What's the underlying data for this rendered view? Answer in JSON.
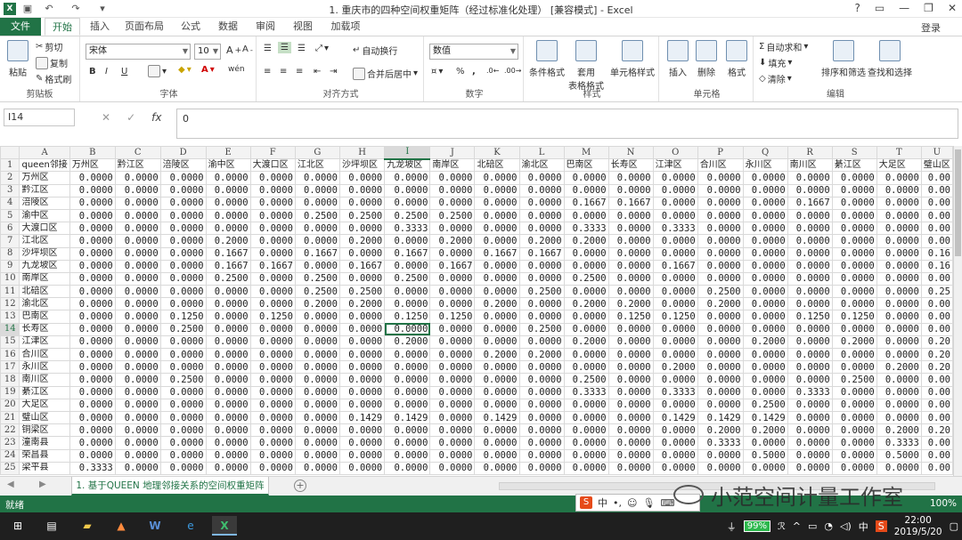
{
  "titlebar": {
    "title": "1. 重庆市的四种空间权重矩阵（经过标准化处理） [兼容模式] - Excel",
    "help": "?",
    "minimize": "—",
    "restore": "❐",
    "close": "✕"
  },
  "ribbon_tabs": [
    "文件",
    "开始",
    "插入",
    "页面布局",
    "公式",
    "数据",
    "审阅",
    "视图",
    "加载项"
  ],
  "login": "登录",
  "ribbon": {
    "clipboard": {
      "paste": "粘贴",
      "cut": "剪切",
      "copy": "复制",
      "format_painter": "格式刷",
      "label": "剪贴板"
    },
    "font": {
      "name": "宋体",
      "size": "10",
      "bold": "B",
      "italic": "I",
      "underline": "U",
      "wen": "wén",
      "label": "字体"
    },
    "alignment": {
      "wrap": "自动换行",
      "merge": "合并后居中",
      "label": "对齐方式"
    },
    "number": {
      "format": "数值",
      "pct": "%",
      "comma": ",",
      "label": "数字"
    },
    "styles": {
      "cond_format": "条件格式",
      "table_format": "套用\n表格格式",
      "cell_style": "单元格样式",
      "label": "样式"
    },
    "cells": {
      "insert": "插入",
      "delete": "删除",
      "format": "格式",
      "label": "单元格"
    },
    "editing": {
      "autosum": "自动求和",
      "fill": "填充",
      "clear": "清除",
      "sort": "排序和筛选",
      "find": "查找和选择",
      "label": "编辑"
    }
  },
  "formula_bar": {
    "name_box": "I14",
    "fx": "fx",
    "value": "0"
  },
  "grid": {
    "columns": [
      "A",
      "B",
      "C",
      "D",
      "E",
      "F",
      "G",
      "H",
      "I",
      "J",
      "K",
      "L",
      "M",
      "N",
      "O",
      "P",
      "Q",
      "R",
      "S",
      "T",
      "U"
    ],
    "selected_col": "I",
    "selected_row": 14,
    "header_row": [
      "queen邻接",
      "万州区",
      "黔江区",
      "涪陵区",
      "渝中区",
      "大渡口区",
      "江北区",
      "沙坪坝区",
      "九龙坡区",
      "南岸区",
      "北碚区",
      "渝北区",
      "巴南区",
      "长寿区",
      "江津区",
      "合川区",
      "永川区",
      "南川区",
      "綦江区",
      "大足区",
      "璧山区"
    ],
    "rows": [
      {
        "n": 2,
        "name": "万州区",
        "v": [
          "0.0000",
          "0.0000",
          "0.0000",
          "0.0000",
          "0.0000",
          "0.0000",
          "0.0000",
          "0.0000",
          "0.0000",
          "0.0000",
          "0.0000",
          "0.0000",
          "0.0000",
          "0.0000",
          "0.0000",
          "0.0000",
          "0.0000",
          "0.0000",
          "0.0000",
          "0.00"
        ]
      },
      {
        "n": 3,
        "name": "黔江区",
        "v": [
          "0.0000",
          "0.0000",
          "0.0000",
          "0.0000",
          "0.0000",
          "0.0000",
          "0.0000",
          "0.0000",
          "0.0000",
          "0.0000",
          "0.0000",
          "0.0000",
          "0.0000",
          "0.0000",
          "0.0000",
          "0.0000",
          "0.0000",
          "0.0000",
          "0.0000",
          "0.00"
        ]
      },
      {
        "n": 4,
        "name": "涪陵区",
        "v": [
          "0.0000",
          "0.0000",
          "0.0000",
          "0.0000",
          "0.0000",
          "0.0000",
          "0.0000",
          "0.0000",
          "0.0000",
          "0.0000",
          "0.0000",
          "0.1667",
          "0.1667",
          "0.0000",
          "0.0000",
          "0.0000",
          "0.1667",
          "0.0000",
          "0.0000",
          "0.00"
        ]
      },
      {
        "n": 5,
        "name": "渝中区",
        "v": [
          "0.0000",
          "0.0000",
          "0.0000",
          "0.0000",
          "0.0000",
          "0.2500",
          "0.2500",
          "0.2500",
          "0.2500",
          "0.0000",
          "0.0000",
          "0.0000",
          "0.0000",
          "0.0000",
          "0.0000",
          "0.0000",
          "0.0000",
          "0.0000",
          "0.0000",
          "0.00"
        ]
      },
      {
        "n": 6,
        "name": "大渡口区",
        "v": [
          "0.0000",
          "0.0000",
          "0.0000",
          "0.0000",
          "0.0000",
          "0.0000",
          "0.0000",
          "0.3333",
          "0.0000",
          "0.0000",
          "0.0000",
          "0.3333",
          "0.0000",
          "0.3333",
          "0.0000",
          "0.0000",
          "0.0000",
          "0.0000",
          "0.0000",
          "0.00"
        ]
      },
      {
        "n": 7,
        "name": "江北区",
        "v": [
          "0.0000",
          "0.0000",
          "0.0000",
          "0.2000",
          "0.0000",
          "0.0000",
          "0.2000",
          "0.0000",
          "0.2000",
          "0.0000",
          "0.2000",
          "0.2000",
          "0.0000",
          "0.0000",
          "0.0000",
          "0.0000",
          "0.0000",
          "0.0000",
          "0.0000",
          "0.00"
        ]
      },
      {
        "n": 8,
        "name": "沙坪坝区",
        "v": [
          "0.0000",
          "0.0000",
          "0.0000",
          "0.1667",
          "0.0000",
          "0.1667",
          "0.0000",
          "0.1667",
          "0.0000",
          "0.1667",
          "0.1667",
          "0.0000",
          "0.0000",
          "0.0000",
          "0.0000",
          "0.0000",
          "0.0000",
          "0.0000",
          "0.0000",
          "0.16"
        ]
      },
      {
        "n": 9,
        "name": "九龙坡区",
        "v": [
          "0.0000",
          "0.0000",
          "0.0000",
          "0.1667",
          "0.1667",
          "0.0000",
          "0.1667",
          "0.0000",
          "0.1667",
          "0.0000",
          "0.0000",
          "0.0000",
          "0.0000",
          "0.1667",
          "0.0000",
          "0.0000",
          "0.0000",
          "0.0000",
          "0.0000",
          "0.16"
        ]
      },
      {
        "n": 10,
        "name": "南岸区",
        "v": [
          "0.0000",
          "0.0000",
          "0.0000",
          "0.2500",
          "0.0000",
          "0.2500",
          "0.0000",
          "0.2500",
          "0.0000",
          "0.0000",
          "0.0000",
          "0.2500",
          "0.0000",
          "0.0000",
          "0.0000",
          "0.0000",
          "0.0000",
          "0.0000",
          "0.0000",
          "0.00"
        ]
      },
      {
        "n": 11,
        "name": "北碚区",
        "v": [
          "0.0000",
          "0.0000",
          "0.0000",
          "0.0000",
          "0.0000",
          "0.2500",
          "0.2500",
          "0.0000",
          "0.0000",
          "0.0000",
          "0.2500",
          "0.0000",
          "0.0000",
          "0.0000",
          "0.2500",
          "0.0000",
          "0.0000",
          "0.0000",
          "0.0000",
          "0.25"
        ]
      },
      {
        "n": 12,
        "name": "渝北区",
        "v": [
          "0.0000",
          "0.0000",
          "0.0000",
          "0.0000",
          "0.0000",
          "0.2000",
          "0.2000",
          "0.0000",
          "0.0000",
          "0.2000",
          "0.0000",
          "0.2000",
          "0.2000",
          "0.0000",
          "0.2000",
          "0.0000",
          "0.0000",
          "0.0000",
          "0.0000",
          "0.00"
        ]
      },
      {
        "n": 13,
        "name": "巴南区",
        "v": [
          "0.0000",
          "0.0000",
          "0.1250",
          "0.0000",
          "0.1250",
          "0.0000",
          "0.0000",
          "0.1250",
          "0.1250",
          "0.0000",
          "0.0000",
          "0.0000",
          "0.1250",
          "0.1250",
          "0.0000",
          "0.0000",
          "0.1250",
          "0.1250",
          "0.0000",
          "0.00"
        ]
      },
      {
        "n": 14,
        "name": "长寿区",
        "v": [
          "0.0000",
          "0.0000",
          "0.2500",
          "0.0000",
          "0.0000",
          "0.0000",
          "0.0000",
          "0.0000",
          "0.0000",
          "0.0000",
          "0.2500",
          "0.0000",
          "0.0000",
          "0.0000",
          "0.0000",
          "0.0000",
          "0.0000",
          "0.0000",
          "0.0000",
          "0.00"
        ]
      },
      {
        "n": 15,
        "name": "江津区",
        "v": [
          "0.0000",
          "0.0000",
          "0.0000",
          "0.0000",
          "0.0000",
          "0.0000",
          "0.0000",
          "0.2000",
          "0.0000",
          "0.0000",
          "0.0000",
          "0.2000",
          "0.0000",
          "0.0000",
          "0.0000",
          "0.2000",
          "0.0000",
          "0.2000",
          "0.0000",
          "0.20"
        ]
      },
      {
        "n": 16,
        "name": "合川区",
        "v": [
          "0.0000",
          "0.0000",
          "0.0000",
          "0.0000",
          "0.0000",
          "0.0000",
          "0.0000",
          "0.0000",
          "0.0000",
          "0.2000",
          "0.2000",
          "0.0000",
          "0.0000",
          "0.0000",
          "0.0000",
          "0.0000",
          "0.0000",
          "0.0000",
          "0.0000",
          "0.20"
        ]
      },
      {
        "n": 17,
        "name": "永川区",
        "v": [
          "0.0000",
          "0.0000",
          "0.0000",
          "0.0000",
          "0.0000",
          "0.0000",
          "0.0000",
          "0.0000",
          "0.0000",
          "0.0000",
          "0.0000",
          "0.0000",
          "0.0000",
          "0.2000",
          "0.0000",
          "0.0000",
          "0.0000",
          "0.0000",
          "0.2000",
          "0.20"
        ]
      },
      {
        "n": 18,
        "name": "南川区",
        "v": [
          "0.0000",
          "0.0000",
          "0.2500",
          "0.0000",
          "0.0000",
          "0.0000",
          "0.0000",
          "0.0000",
          "0.0000",
          "0.0000",
          "0.0000",
          "0.2500",
          "0.0000",
          "0.0000",
          "0.0000",
          "0.0000",
          "0.0000",
          "0.2500",
          "0.0000",
          "0.00"
        ]
      },
      {
        "n": 19,
        "name": "綦江区",
        "v": [
          "0.0000",
          "0.0000",
          "0.0000",
          "0.0000",
          "0.0000",
          "0.0000",
          "0.0000",
          "0.0000",
          "0.0000",
          "0.0000",
          "0.0000",
          "0.3333",
          "0.0000",
          "0.3333",
          "0.0000",
          "0.0000",
          "0.3333",
          "0.0000",
          "0.0000",
          "0.00"
        ]
      },
      {
        "n": 20,
        "name": "大足区",
        "v": [
          "0.0000",
          "0.0000",
          "0.0000",
          "0.0000",
          "0.0000",
          "0.0000",
          "0.0000",
          "0.0000",
          "0.0000",
          "0.0000",
          "0.0000",
          "0.0000",
          "0.0000",
          "0.0000",
          "0.0000",
          "0.2500",
          "0.0000",
          "0.0000",
          "0.0000",
          "0.00"
        ]
      },
      {
        "n": 21,
        "name": "璧山区",
        "v": [
          "0.0000",
          "0.0000",
          "0.0000",
          "0.0000",
          "0.0000",
          "0.0000",
          "0.1429",
          "0.1429",
          "0.0000",
          "0.1429",
          "0.0000",
          "0.0000",
          "0.0000",
          "0.1429",
          "0.1429",
          "0.1429",
          "0.0000",
          "0.0000",
          "0.0000",
          "0.00"
        ]
      },
      {
        "n": 22,
        "name": "铜梁区",
        "v": [
          "0.0000",
          "0.0000",
          "0.0000",
          "0.0000",
          "0.0000",
          "0.0000",
          "0.0000",
          "0.0000",
          "0.0000",
          "0.0000",
          "0.0000",
          "0.0000",
          "0.0000",
          "0.0000",
          "0.2000",
          "0.2000",
          "0.0000",
          "0.0000",
          "0.2000",
          "0.20"
        ]
      },
      {
        "n": 23,
        "name": "潼南县",
        "v": [
          "0.0000",
          "0.0000",
          "0.0000",
          "0.0000",
          "0.0000",
          "0.0000",
          "0.0000",
          "0.0000",
          "0.0000",
          "0.0000",
          "0.0000",
          "0.0000",
          "0.0000",
          "0.0000",
          "0.3333",
          "0.0000",
          "0.0000",
          "0.0000",
          "0.3333",
          "0.00"
        ]
      },
      {
        "n": 24,
        "name": "荣昌县",
        "v": [
          "0.0000",
          "0.0000",
          "0.0000",
          "0.0000",
          "0.0000",
          "0.0000",
          "0.0000",
          "0.0000",
          "0.0000",
          "0.0000",
          "0.0000",
          "0.0000",
          "0.0000",
          "0.0000",
          "0.0000",
          "0.5000",
          "0.0000",
          "0.0000",
          "0.5000",
          "0.00"
        ]
      },
      {
        "n": 25,
        "name": "梁平县",
        "v": [
          "0.3333",
          "0.0000",
          "0.0000",
          "0.0000",
          "0.0000",
          "0.0000",
          "0.0000",
          "0.0000",
          "0.0000",
          "0.0000",
          "0.0000",
          "0.0000",
          "0.0000",
          "0.0000",
          "0.0000",
          "0.0000",
          "0.0000",
          "0.0000",
          "0.0000",
          "0.00"
        ]
      }
    ]
  },
  "sheet_tab": "1. 基于QUEEN 地理邻接关系的空间权重矩阵",
  "status": {
    "ready": "就绪",
    "zoom": "100%"
  },
  "watermark": "小范空间计量工作室",
  "ime": {
    "s": "S",
    "lang": "中"
  },
  "taskbar": {
    "battery": "99%",
    "ime_lang": "中",
    "time": "22:00",
    "date": "2019/5/20"
  }
}
